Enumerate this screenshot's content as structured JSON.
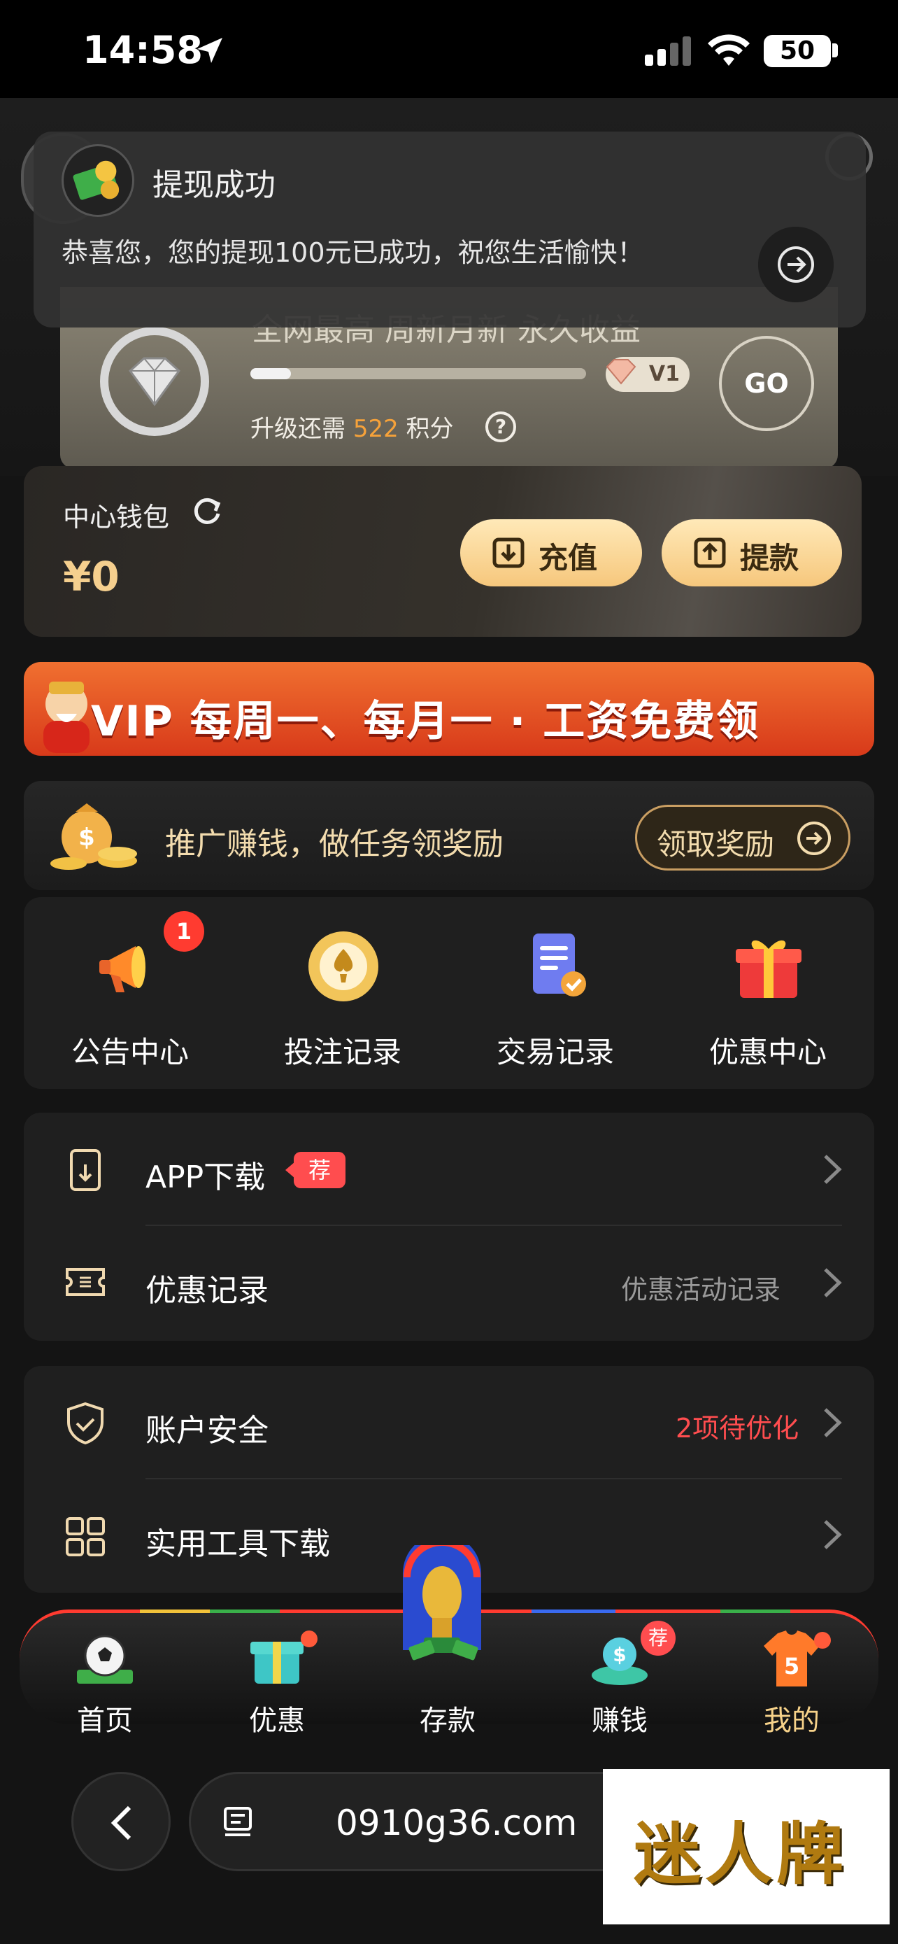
{
  "status_bar": {
    "time": "14:58",
    "battery": "50"
  },
  "toast": {
    "title": "提现成功",
    "body": "恭喜您，您的提现100元已成功，祝您生活愉快！"
  },
  "vip_card": {
    "tagline": "全网最高 周新月新 永久收益",
    "level": "V1",
    "upgrade_prefix": "升级还需",
    "upgrade_points": "522",
    "upgrade_suffix": "积分",
    "progress_fraction": 0.12,
    "go_label": "GO"
  },
  "wallet": {
    "title": "中心钱包",
    "amount": "¥0",
    "recharge_label": "充值",
    "withdraw_label": "提款"
  },
  "banner": {
    "text": "VIP 每周一、每月一 · 工资免费领"
  },
  "promo": {
    "text": "推广赚钱，做任务领奖励",
    "button": "领取奖励"
  },
  "quick_actions": [
    {
      "label": "公告中心",
      "icon": "megaphone-icon",
      "badge": "1"
    },
    {
      "label": "投注记录",
      "icon": "chip-icon"
    },
    {
      "label": "交易记录",
      "icon": "document-icon"
    },
    {
      "label": "优惠中心",
      "icon": "gift-icon"
    }
  ],
  "list_group_1": [
    {
      "label": "APP下载",
      "tag": "荐",
      "right": ""
    },
    {
      "label": "优惠记录",
      "right": "优惠活动记录"
    }
  ],
  "list_group_2": [
    {
      "label": "账户安全",
      "right": "2项待优化"
    },
    {
      "label": "实用工具下载",
      "right": ""
    }
  ],
  "tab_bar": [
    {
      "label": "首页",
      "icon": "soccer-icon"
    },
    {
      "label": "优惠",
      "icon": "gift-box-icon"
    },
    {
      "label": "存款",
      "icon": "trophy-icon"
    },
    {
      "label": "赚钱",
      "icon": "money-icon",
      "tag": "荐"
    },
    {
      "label": "我的",
      "icon": "jersey-icon",
      "jersey_number": "5"
    }
  ],
  "browser": {
    "url": "0910g36.com"
  },
  "watermark": "迷人牌",
  "colors": {
    "accent_gold": "#f5cf8e",
    "alert_red": "#ff4d4f",
    "background": "#141414"
  }
}
